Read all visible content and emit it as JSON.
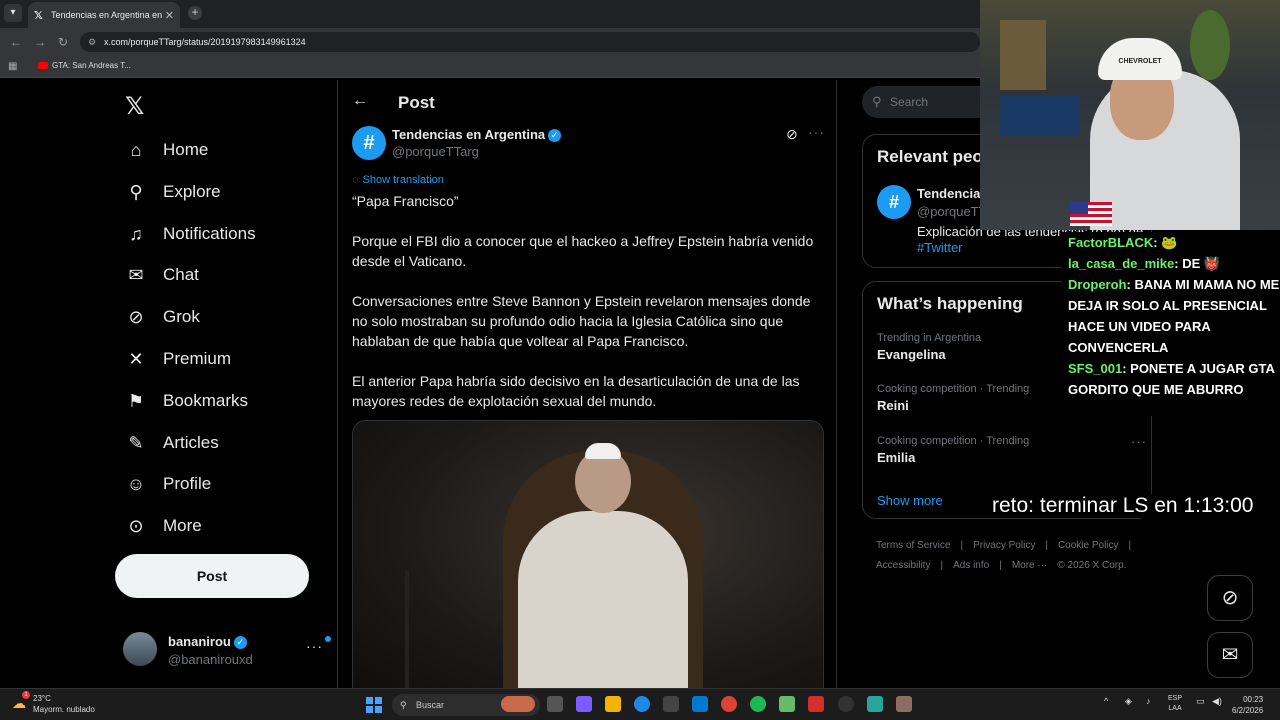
{
  "browser": {
    "tab_title": "Tendencias en Argentina en X: \"",
    "tab_close": "✕",
    "new_tab": "+",
    "url": "x.com/porqueTTarg/status/2019197983149961324",
    "bookmark": "GTA: San Andreas T..."
  },
  "nav": {
    "items": [
      {
        "label": "Home"
      },
      {
        "label": "Explore"
      },
      {
        "label": "Notifications"
      },
      {
        "label": "Chat"
      },
      {
        "label": "Grok"
      },
      {
        "label": "Premium"
      },
      {
        "label": "Bookmarks"
      },
      {
        "label": "Articles"
      },
      {
        "label": "Profile"
      },
      {
        "label": "More"
      }
    ],
    "post_button": "Post",
    "user": {
      "name": "bananirou",
      "handle": "@bananirouxd"
    }
  },
  "post": {
    "header_title": "Post",
    "author_name": "Tendencias en Argentina",
    "author_handle": "@porqueTTarg",
    "show_translation": "Show translation",
    "paragraphs": [
      "“Papa Francisco”",
      "Porque el FBI dio a conocer que el hackeo a Jeffrey Epstein habría venido desde el Vaticano.",
      "Conversaciones entre Steve Bannon y Epstein revelaron mensajes donde no solo mostraban su profundo odio hacia la Iglesia Católica sino que hablaban de que había que voltear al Papa Francisco.",
      "El anterior Papa habría sido decisivo en la desarticulación de una de las mayores redes de explotación sexual del mundo."
    ]
  },
  "sidebar": {
    "search_placeholder": "Search",
    "relevant_title": "Relevant peo",
    "relevant_person": {
      "name": "Tendencias",
      "handle": "@porqueTT",
      "bio": "Explicación de las tendencias (o no) de",
      "link": "#Twitter"
    },
    "happening_title": "What’s happening",
    "trends": [
      {
        "context": "Trending in Argentina",
        "title": "Evangelina"
      },
      {
        "context": "Cooking competition · Trending",
        "title": "Reini"
      },
      {
        "context": "Cooking competition · Trending",
        "title": "Emilia"
      }
    ],
    "show_more": "Show more",
    "footer": [
      "Terms of Service",
      "|",
      "Privacy Policy",
      "|",
      "Cookie Policy",
      "|",
      "Accessibility",
      "|",
      "Ads info",
      "|",
      "More ···",
      "© 2026 X Corp."
    ]
  },
  "overlay": {
    "cap_text": "CHEVROLET",
    "chat": [
      {
        "user": "FactorBLACK",
        "msg": ": 🐸"
      },
      {
        "user": "la_casa_de_mike",
        "msg": ": DE 👹"
      },
      {
        "user": "Droperoh",
        "msg": ": BANA MI MAMA NO ME DEJA IR SOLO AL PRESENCIAL HACE UN VIDEO PARA CONVENCERLA"
      },
      {
        "user": "SFS_001",
        "msg": ": PONETE A JUGAR GTA GORDITO QUE ME ABURRO"
      }
    ],
    "reto": "reto: terminar LS en 1:13:00"
  },
  "taskbar": {
    "temp": "23°C",
    "weather": "Mayorm. nublado",
    "weather_badge": "1",
    "search": "Buscar",
    "lang1": "ESP",
    "lang2": "LAA",
    "time": "00:23",
    "date": "6/2/2026"
  },
  "colors": {
    "accent": "#1d9bf0",
    "chat_user": "#6cf06c"
  }
}
